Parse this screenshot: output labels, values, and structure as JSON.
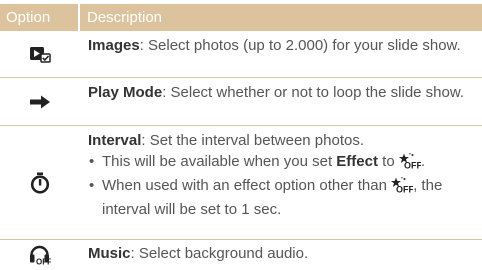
{
  "header": {
    "option": "Option",
    "description": "Description"
  },
  "rows": [
    {
      "icon": "slideshow-images-icon",
      "term": "Images",
      "text": ": Select photos (up to 2.000) for your slide show."
    },
    {
      "icon": "right-arrow-icon",
      "term": "Play Mode",
      "text": ": Select whether or not to loop the slide show."
    },
    {
      "icon": "interval-timer-icon",
      "term": "Interval",
      "text": ": Set the interval between photos.",
      "bullets": [
        {
          "pre": "This will be available when you set ",
          "bold": "Effect",
          "mid": " to ",
          "post": "."
        },
        {
          "pre": "When used with an effect option other than ",
          "post": ", the interval will be set to 1 sec."
        }
      ]
    },
    {
      "icon": "music-off-icon",
      "term": "Music",
      "text": ": Select background audio."
    }
  ],
  "colors": {
    "header_bg": "#dcc39d",
    "rule": "#d9c4a3",
    "text": "#555555",
    "icon": "#222222"
  }
}
